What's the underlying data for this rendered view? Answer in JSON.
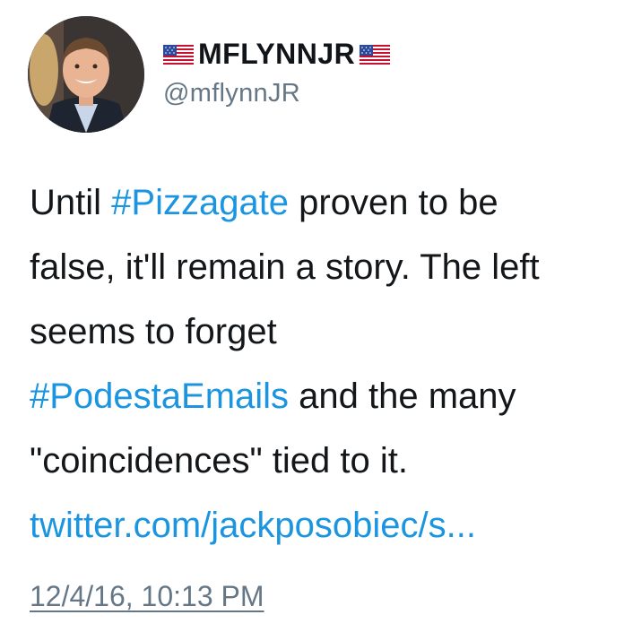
{
  "author": {
    "display_name": "MFLYNNJR",
    "handle": "@mflynnJR",
    "flag_icon": "us-flag-icon",
    "avatar_icon": "avatar-photo"
  },
  "tweet": {
    "lines": [
      [
        {
          "type": "text",
          "value": "Until "
        },
        {
          "type": "hashtag",
          "value": "#Pizzagate"
        },
        {
          "type": "text",
          "value": " proven to be"
        }
      ],
      [
        {
          "type": "text",
          "value": "false, it'll remain a story. The left"
        }
      ],
      [
        {
          "type": "text",
          "value": "seems to forget"
        }
      ],
      [
        {
          "type": "hashtag",
          "value": "#PodestaEmails"
        },
        {
          "type": "text",
          "value": " and the many"
        }
      ],
      [
        {
          "type": "text",
          "value": "\"coincidences\" tied to it."
        }
      ],
      [
        {
          "type": "link",
          "value": "twitter.com/jackposobiec/s..."
        }
      ]
    ],
    "timestamp": "12/4/16, 10:13 PM"
  },
  "colors": {
    "link": "#1b95e0",
    "secondary_text": "#657786",
    "primary_text": "#14171a"
  }
}
